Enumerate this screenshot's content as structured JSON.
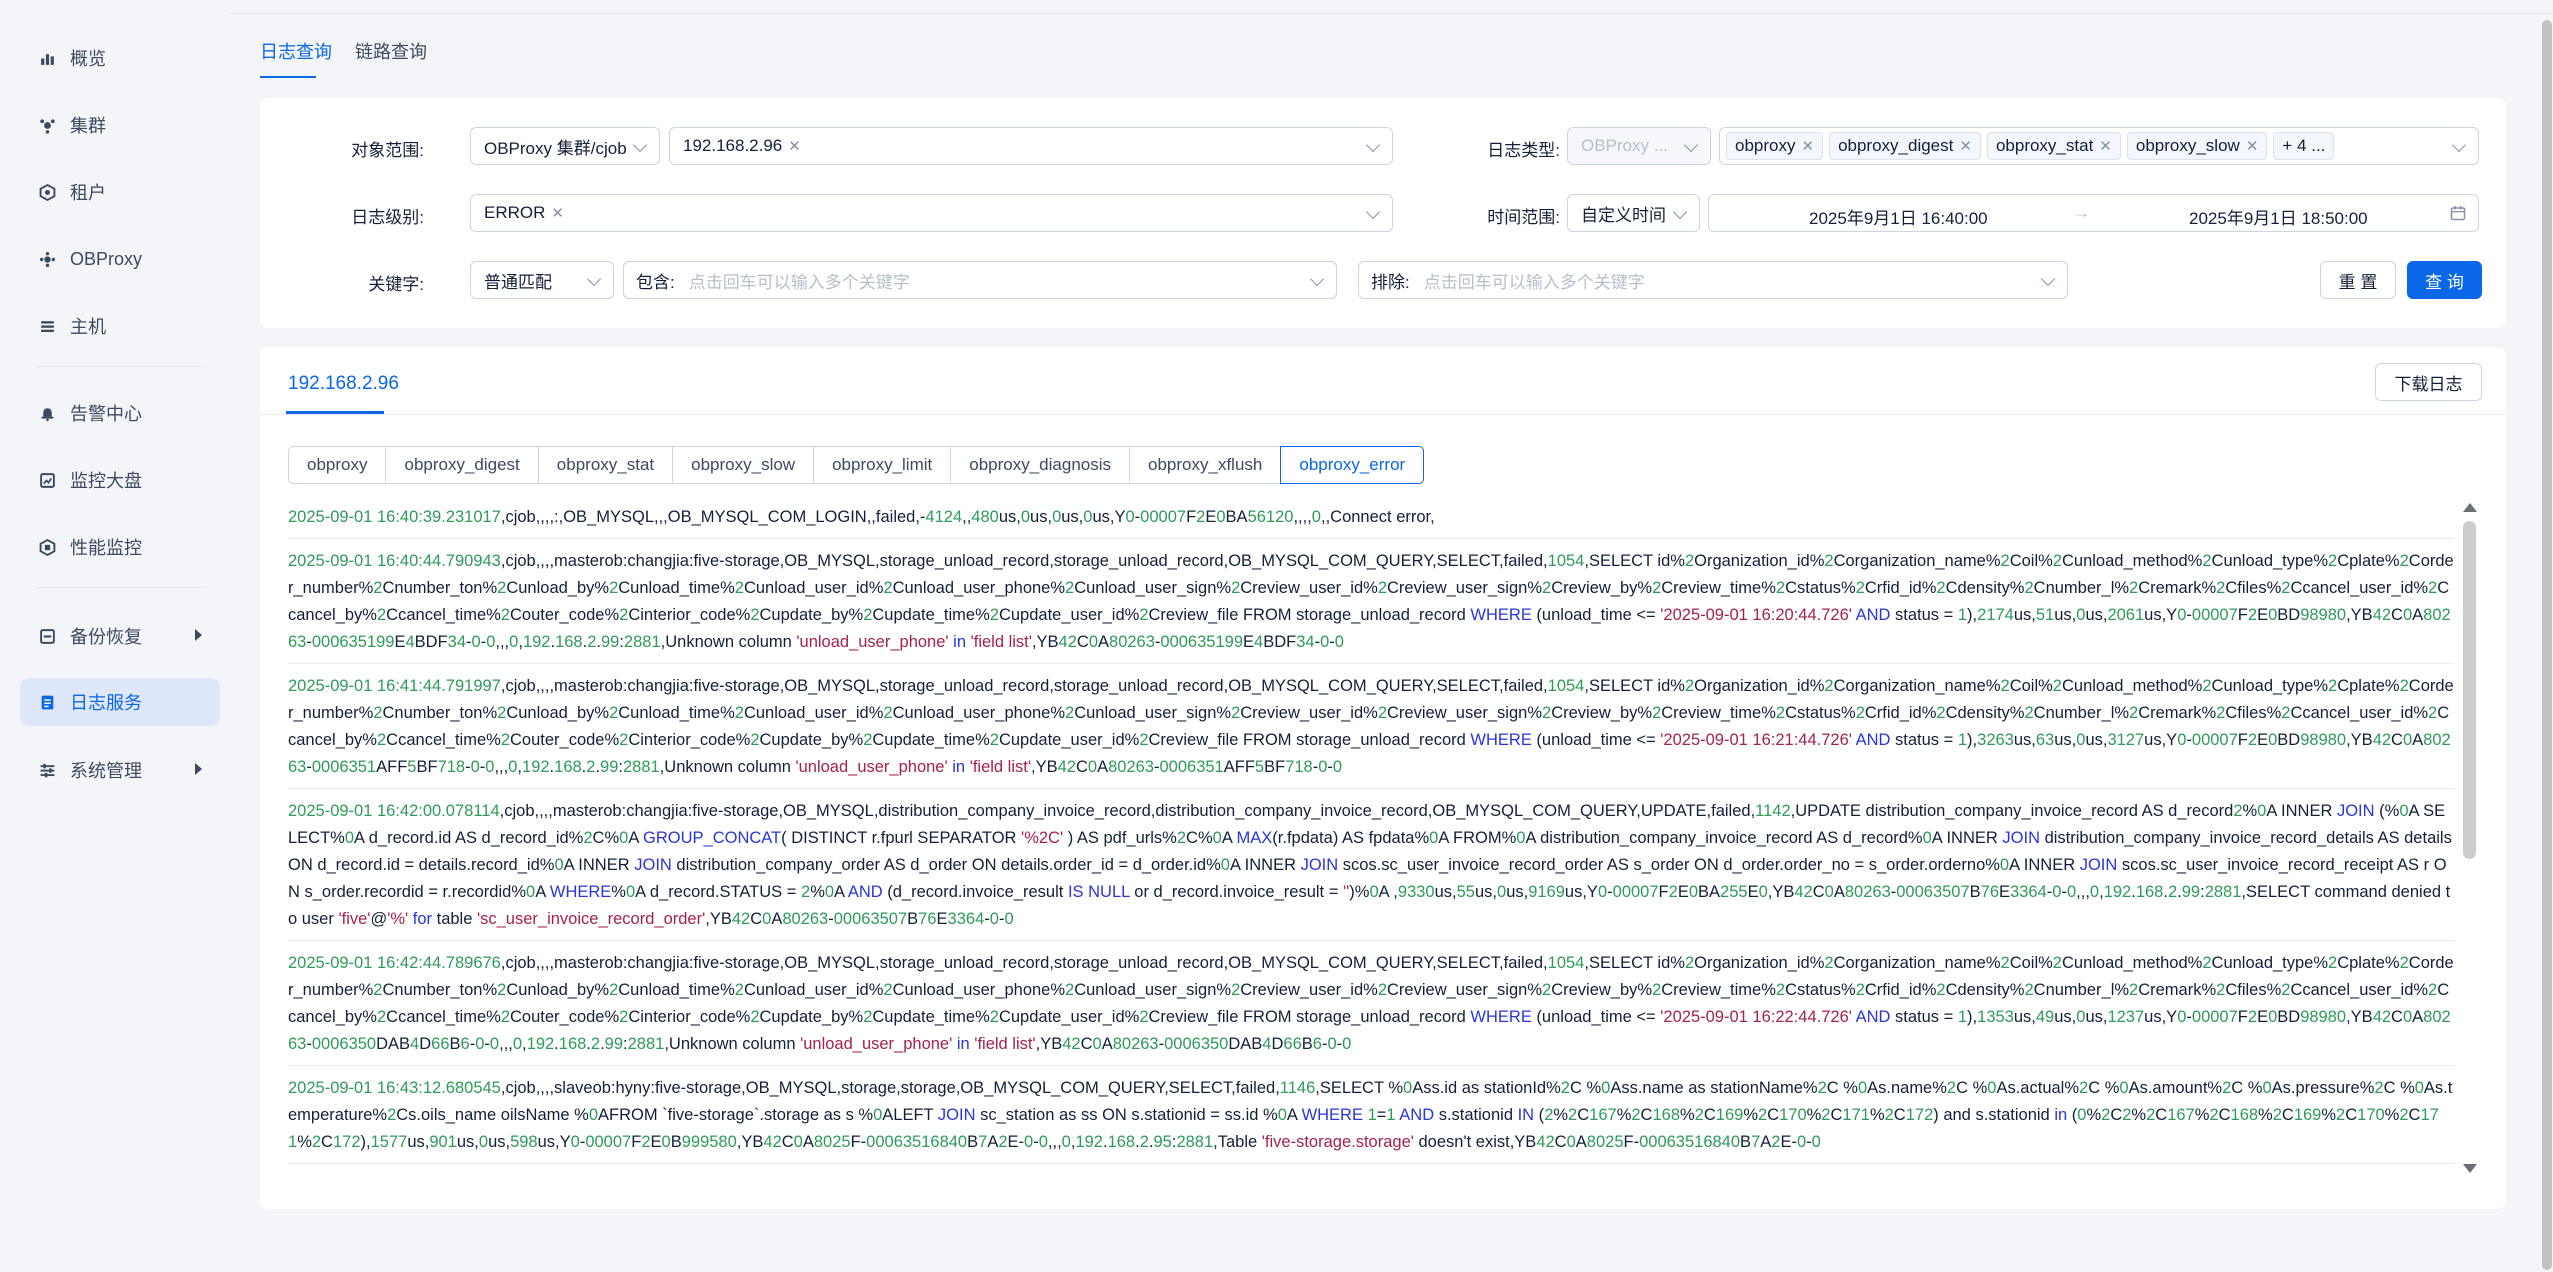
{
  "sidebar": {
    "items": [
      {
        "label": "概览",
        "icon": "bar-chart-icon"
      },
      {
        "label": "集群",
        "icon": "cluster-icon"
      },
      {
        "label": "租户",
        "icon": "tenant-icon"
      },
      {
        "label": "OBProxy",
        "icon": "proxy-icon"
      },
      {
        "label": "主机",
        "icon": "host-icon"
      },
      {
        "label": "告警中心",
        "icon": "bell-icon"
      },
      {
        "label": "监控大盘",
        "icon": "dashboard-icon"
      },
      {
        "label": "性能监控",
        "icon": "performance-icon"
      },
      {
        "label": "备份恢复",
        "icon": "backup-icon"
      },
      {
        "label": "日志服务",
        "icon": "log-icon"
      },
      {
        "label": "系统管理",
        "icon": "settings-icon"
      }
    ],
    "active": "日志服务"
  },
  "page_tabs": [
    {
      "label": "日志查询",
      "active": true
    },
    {
      "label": "链路查询",
      "active": false
    }
  ],
  "filters": {
    "scope_label": "对象范围:",
    "scope_value": "OBProxy 集群/cjob",
    "scope_host": "192.168.2.96",
    "log_type_label": "日志类型:",
    "log_type_select": "OBProxy ...",
    "log_type_tags": [
      "obproxy",
      "obproxy_digest",
      "obproxy_stat",
      "obproxy_slow"
    ],
    "log_type_more": "+ 4 ...",
    "level_label": "日志级别:",
    "level_tag": "ERROR",
    "time_label": "时间范围:",
    "time_mode": "自定义时间",
    "time_start": "2025年9月1日 16:40:00",
    "time_arrow": "→",
    "time_end": "2025年9月1日 18:50:00",
    "keyword_label": "关键字:",
    "match_mode": "普通匹配",
    "include_label": "包含:",
    "include_placeholder": "点击回车可以输入多个关键字",
    "exclude_label": "排除:",
    "exclude_placeholder": "点击回车可以输入多个关键字",
    "reset_button": "重 置",
    "search_button": "查 询"
  },
  "log_panel": {
    "host_tab": "192.168.2.96",
    "download_button": "下载日志",
    "log_tabs": [
      "obproxy",
      "obproxy_digest",
      "obproxy_stat",
      "obproxy_slow",
      "obproxy_limit",
      "obproxy_diagnosis",
      "obproxy_xflush",
      "obproxy_error"
    ],
    "active_log_tab": "obproxy_error",
    "entries": [
      "2025-09-01 16:40:39.231017,cjob,,,,:,OB_MYSQL,,,OB_MYSQL_COM_LOGIN,,failed,-4124,,480us,0us,0us,0us,Y0-00007F2E0BA56120,,,,0,,Connect error,",
      "2025-09-01 16:40:44.790943,cjob,,,,masterob:changjia:five-storage,OB_MYSQL,storage_unload_record,storage_unload_record,OB_MYSQL_COM_QUERY,SELECT,failed,1054,SELECT id%2Organization_id%2Corganization_name%2Coil%2Cunload_method%2Cunload_type%2Cplate%2Corder_number%2Cnumber_ton%2Cunload_by%2Cunload_time%2Cunload_user_id%2Cunload_user_phone%2Cunload_user_sign%2Creview_user_id%2Creview_user_sign%2Creview_by%2Creview_time%2Cstatus%2Crfid_id%2Cdensity%2Cnumber_l%2Cremark%2Cfiles%2Ccancel_user_id%2Ccancel_by%2Ccancel_time%2Couter_code%2Cinterior_code%2Cupdate_by%2Cupdate_time%2Cupdate_user_id%2Creview_file FROM storage_unload_record WHERE (unload_time <= '2025-09-01 16:20:44.726' AND status = 1),2174us,51us,0us,2061us,Y0-00007F2E0BD98980,YB42C0A80263-000635199E4BDF34-0-0,,,0,192.168.2.99:2881,Unknown column 'unload_user_phone' in 'field list',YB42C0A80263-000635199E4BDF34-0-0",
      "2025-09-01 16:41:44.791997,cjob,,,,masterob:changjia:five-storage,OB_MYSQL,storage_unload_record,storage_unload_record,OB_MYSQL_COM_QUERY,SELECT,failed,1054,SELECT id%2Organization_id%2Corganization_name%2Coil%2Cunload_method%2Cunload_type%2Cplate%2Corder_number%2Cnumber_ton%2Cunload_by%2Cunload_time%2Cunload_user_id%2Cunload_user_phone%2Cunload_user_sign%2Creview_user_id%2Creview_user_sign%2Creview_by%2Creview_time%2Cstatus%2Crfid_id%2Cdensity%2Cnumber_l%2Cremark%2Cfiles%2Ccancel_user_id%2Ccancel_by%2Ccancel_time%2Couter_code%2Cinterior_code%2Cupdate_by%2Cupdate_time%2Cupdate_user_id%2Creview_file FROM storage_unload_record WHERE (unload_time <= '2025-09-01 16:21:44.726' AND status = 1),3263us,63us,0us,3127us,Y0-00007F2E0BD98980,YB42C0A80263-0006351AFF5BF718-0-0,,,0,192.168.2.99:2881,Unknown column 'unload_user_phone' in 'field list',YB42C0A80263-0006351AFF5BF718-0-0",
      "2025-09-01 16:42:00.078114,cjob,,,,masterob:changjia:five-storage,OB_MYSQL,distribution_company_invoice_record,distribution_company_invoice_record,OB_MYSQL_COM_QUERY,UPDATE,failed,1142,UPDATE distribution_company_invoice_record AS d_record2%0A INNER JOIN (%0A SELECT%0A d_record.id AS d_record_id%2C%0A GROUP_CONCAT( DISTINCT r.fpurl SEPARATOR '%2C' ) AS pdf_urls%2C%0A MAX(r.fpdata) AS fpdata%0A FROM%0A distribution_company_invoice_record AS d_record%0A INNER JOIN distribution_company_invoice_record_details AS details ON d_record.id = details.record_id%0A INNER JOIN distribution_company_order AS d_order ON details.order_id = d_order.id%0A INNER JOIN scos.sc_user_invoice_record_order AS s_order ON d_order.order_no = s_order.orderno%0A INNER JOIN scos.sc_user_invoice_record_receipt AS r ON s_order.recordid = r.recordid%0A WHERE%0A d_record.STATUS = 2%0A AND (d_record.invoice_result IS NULL or d_record.invoice_result = '')%0A ,9330us,55us,0us,9169us,Y0-00007F2E0BA255E0,YB42C0A80263-00063507B76E3364-0-0,,,0,192.168.2.99:2881,SELECT command denied to user 'five'@'%' for table 'sc_user_invoice_record_order',YB42C0A80263-00063507B76E3364-0-0",
      "2025-09-01 16:42:44.789676,cjob,,,,masterob:changjia:five-storage,OB_MYSQL,storage_unload_record,storage_unload_record,OB_MYSQL_COM_QUERY,SELECT,failed,1054,SELECT id%2Organization_id%2Corganization_name%2Coil%2Cunload_method%2Cunload_type%2Cplate%2Corder_number%2Cnumber_ton%2Cunload_by%2Cunload_time%2Cunload_user_id%2Cunload_user_phone%2Cunload_user_sign%2Creview_user_id%2Creview_user_sign%2Creview_by%2Creview_time%2Cstatus%2Crfid_id%2Cdensity%2Cnumber_l%2Cremark%2Cfiles%2Ccancel_user_id%2Ccancel_by%2Ccancel_time%2Couter_code%2Cinterior_code%2Cupdate_by%2Cupdate_time%2Cupdate_user_id%2Creview_file FROM storage_unload_record WHERE (unload_time <= '2025-09-01 16:22:44.726' AND status = 1),1353us,49us,0us,1237us,Y0-00007F2E0BD98980,YB42C0A80263-0006350DAB4D66B6-0-0,,,0,192.168.2.99:2881,Unknown column 'unload_user_phone' in 'field list',YB42C0A80263-0006350DAB4D66B6-0-0",
      "2025-09-01 16:43:12.680545,cjob,,,,slaveob:hyny:five-storage,OB_MYSQL,storage,storage,OB_MYSQL_COM_QUERY,SELECT,failed,1146,SELECT %0Ass.id as stationId%2C %0Ass.name as stationName%2C %0As.name%2C %0As.actual%2C %0As.amount%2C %0As.pressure%2C %0As.temperature%2Cs.oils_name oilsName %0AFROM `five-storage`.storage as s %0ALEFT JOIN sc_station as ss ON s.stationid = ss.id %0A WHERE 1=1 AND s.stationid IN (2%2C167%2C168%2C169%2C170%2C171%2C172) and s.stationid in (0%2C2%2C167%2C168%2C169%2C170%2C171%2C172),1577us,901us,0us,598us,Y0-00007F2E0B999580,YB42C0A8025F-00063516840B7A2E-0-0,,,0,192.168.2.95:2881,Table 'five-storage.storage' doesn't exist,YB42C0A8025F-00063516840B7A2E-0-0"
    ]
  },
  "colors": {
    "accent": "#0a67e8",
    "timestamp": "#2f9a5b",
    "keyword": "#2b35d8",
    "string": "#a4224f"
  }
}
